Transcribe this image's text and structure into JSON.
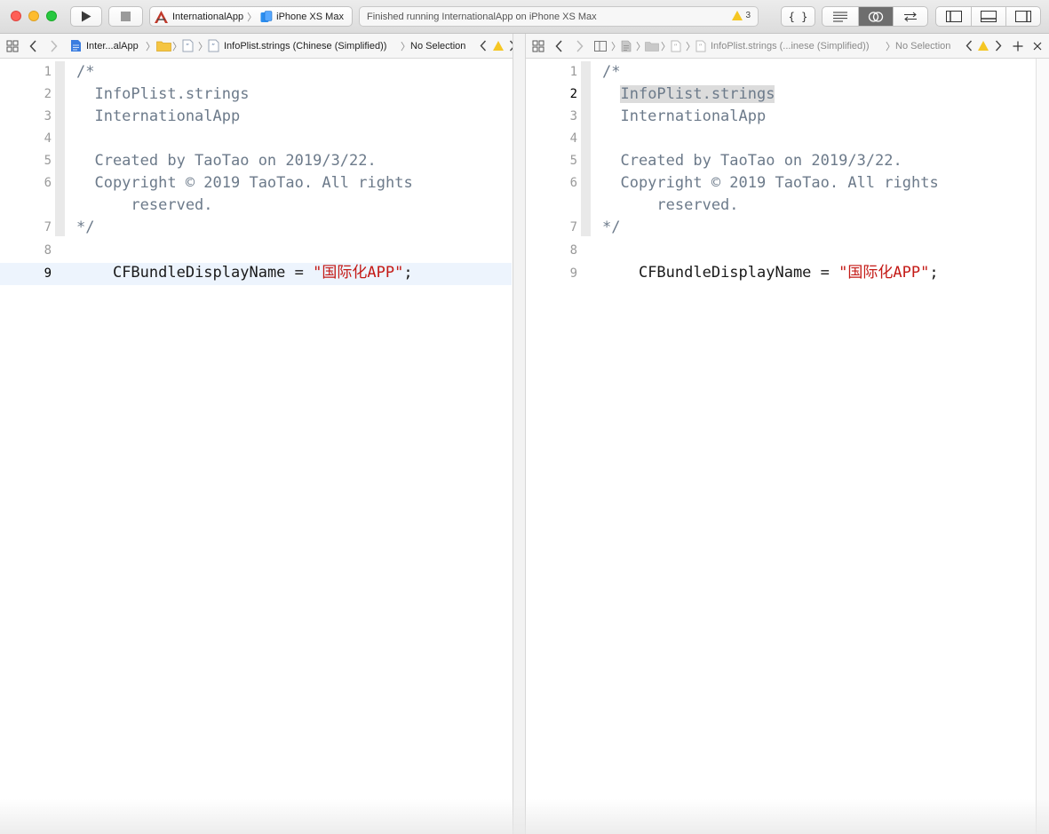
{
  "toolbar": {
    "scheme_name": "InternationalApp",
    "device_name": "iPhone XS Max",
    "activity_status": "Finished running InternationalApp on iPhone XS Max",
    "warning_count": "3",
    "code_review_label": "{ }",
    "colors": {
      "close": "#fe5f57",
      "minimize": "#febc2e",
      "zoom": "#28c840"
    }
  },
  "left_jumpbar": {
    "project": "Inter...alApp",
    "file": "InfoPlist.strings (Chinese (Simplified))",
    "selection": "No Selection"
  },
  "right_jumpbar": {
    "file": "InfoPlist.strings (...inese (Simplified))",
    "selection": "No Selection"
  },
  "editor": {
    "line_numbers": [
      "1",
      "2",
      "3",
      "4",
      "5",
      "6",
      "7",
      "8",
      "9"
    ],
    "comment_open": "/*",
    "comment_line_2": "  InfoPlist.strings",
    "comment_line_3": "  InternationalApp",
    "comment_line_5": "  Created by TaoTao on 2019/3/22.",
    "comment_line_6a": "  Copyright © 2019 TaoTao. All rights",
    "comment_line_6b": "      reserved.",
    "comment_close": "*/",
    "key": "CFBundleDisplayName = ",
    "value": "\"国际化APP\"",
    "terminator": ";",
    "left_current_line": "9",
    "right_current_line": "2",
    "highlighted_word": "InfoPlist.strings"
  }
}
